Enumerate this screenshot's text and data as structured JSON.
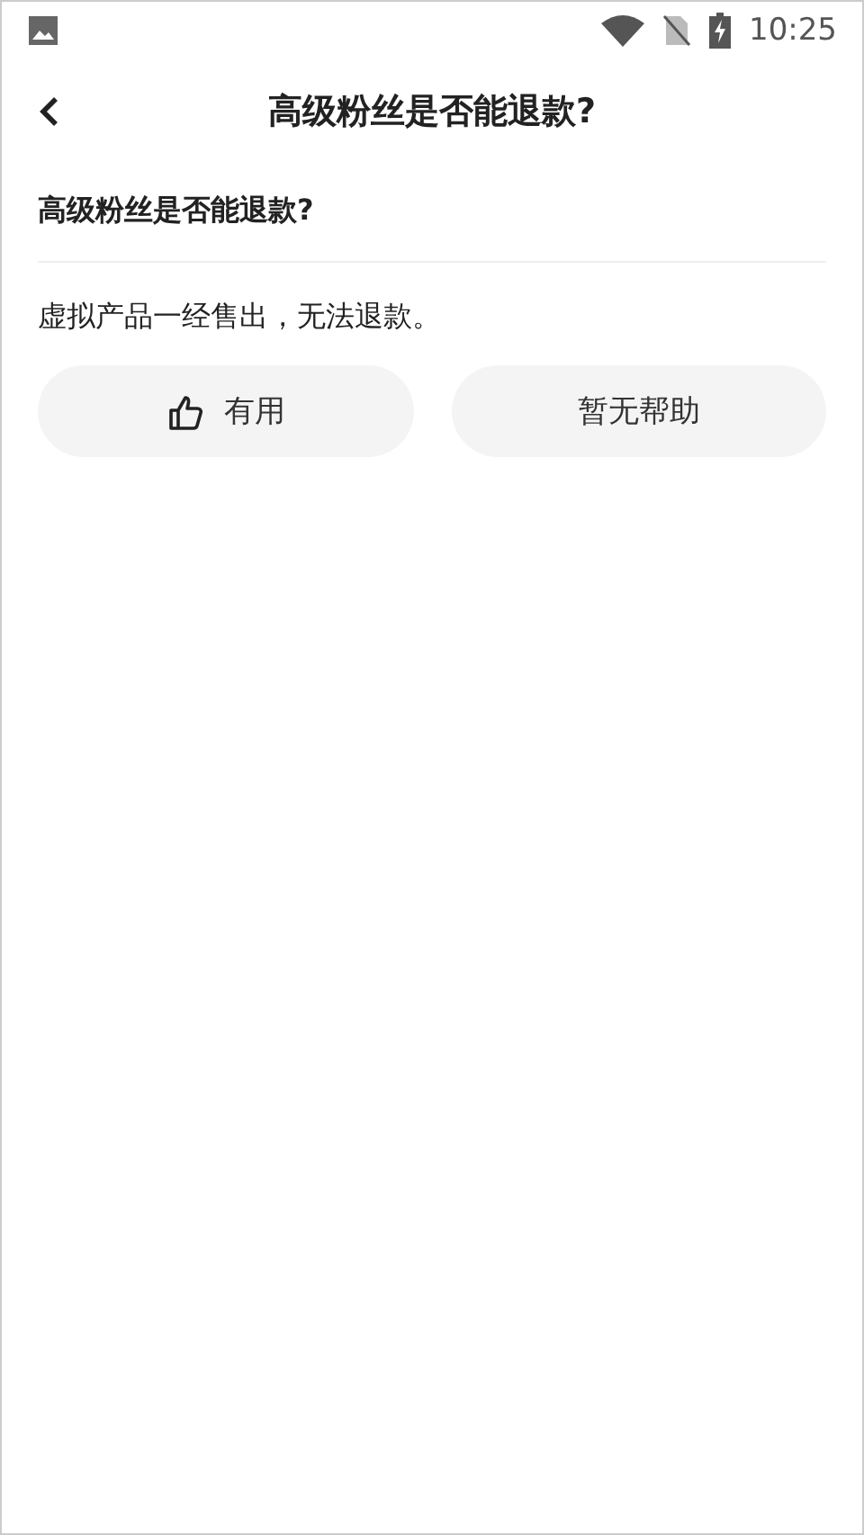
{
  "status_bar": {
    "time": "10:25"
  },
  "header": {
    "title": "高级粉丝是否能退款?"
  },
  "question": "高级粉丝是否能退款?",
  "answer": "虚拟产品一经售出，无法退款。",
  "buttons": [
    {
      "kind": "like",
      "label": "有用"
    },
    {
      "kind": "plain",
      "label": "暂无帮助"
    }
  ]
}
